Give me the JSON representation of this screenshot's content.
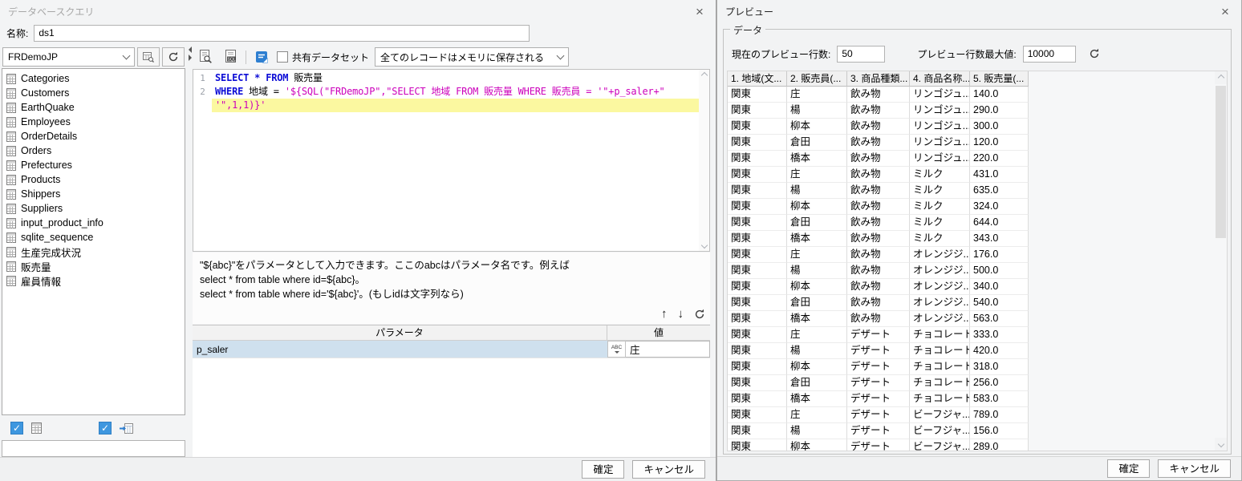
{
  "query_dialog": {
    "title": "データベースクエリ",
    "name_label": "名称:",
    "name_value": "ds1",
    "connection": {
      "selected": "FRDemoJP",
      "edit_icon": "connection-edit-icon",
      "refresh_icon": "refresh-icon"
    },
    "tables": [
      "Categories",
      "Customers",
      "EarthQuake",
      "Employees",
      "OrderDetails",
      "Orders",
      "Prefectures",
      "Products",
      "Shippers",
      "Suppliers",
      "input_product_info",
      "sqlite_sequence",
      "生産完成状況",
      "販売量",
      "雇員情報"
    ],
    "bottom_checkboxes": {
      "dataset_checked": true,
      "view_checked": true,
      "check_glyph": "✓"
    },
    "toolbar": {
      "preview_icon": "sql-preview-icon",
      "sql_icon": "sql-file-icon",
      "format_icon": "format-sql-icon",
      "share_label": "共有データセット",
      "share_checked": false,
      "storage_value": "全てのレコードはメモリに保存される"
    },
    "sql_lines": [
      {
        "num": "1",
        "highlight": false,
        "segments": [
          {
            "cls": "kw",
            "text": "SELECT"
          },
          {
            "cls": "kw",
            "text": " * "
          },
          {
            "cls": "kw",
            "text": "FROM"
          },
          {
            "cls": "plain",
            "text": " 販売量"
          }
        ]
      },
      {
        "num": "2",
        "highlight": false,
        "segments": [
          {
            "cls": "kw",
            "text": "WHERE"
          },
          {
            "cls": "plain",
            "text": " 地域 = "
          },
          {
            "cls": "str",
            "text": "'${SQL(\"FRDemoJP\",\"SELECT 地域 FROM 販売量 WHERE 販売員 = '\"+p_saler+\""
          }
        ]
      },
      {
        "num": "",
        "highlight": true,
        "segments": [
          {
            "cls": "str",
            "text": "'\",1,1)}'"
          }
        ]
      }
    ],
    "help_lines": [
      "\"${abc}\"をパラメータとして入力できます。ここのabcはパラメータ名です。例えば",
      "select * from table where id=${abc}。",
      "select * from table where id='${abc}'。(もしidは文字列なら)"
    ],
    "param_controls": {
      "up_glyph": "↑",
      "down_glyph": "↓",
      "refresh_icon": "refresh-icon"
    },
    "param_table": {
      "headers": [
        "パラメータ",
        "値"
      ],
      "rows": [
        {
          "name": "p_saler",
          "type_label": "ABC",
          "value": "庄"
        }
      ]
    },
    "filter_value": "",
    "footer": {
      "ok_label": "確定",
      "cancel_label": "キャンセル"
    }
  },
  "preview_panel": {
    "title": "プレビュー",
    "group_label": "データ",
    "current_rows_label": "現在のプレビュー行数:",
    "current_rows_value": "50",
    "max_rows_label": "プレビュー行数最大値:",
    "max_rows_value": "10000",
    "refresh_icon": "refresh-icon",
    "table": {
      "headers": [
        "1. 地域(文...",
        "2. 販売員(...",
        "3. 商品種類...",
        "4. 商品名称...",
        "5. 販売量(..."
      ],
      "rows": [
        [
          "関東",
          "庄",
          "飲み物",
          "リンゴジュ...",
          "140.0"
        ],
        [
          "関東",
          "楊",
          "飲み物",
          "リンゴジュ...",
          "290.0"
        ],
        [
          "関東",
          "柳本",
          "飲み物",
          "リンゴジュ...",
          "300.0"
        ],
        [
          "関東",
          "倉田",
          "飲み物",
          "リンゴジュ...",
          "120.0"
        ],
        [
          "関東",
          "橋本",
          "飲み物",
          "リンゴジュ...",
          "220.0"
        ],
        [
          "関東",
          "庄",
          "飲み物",
          "ミルク",
          "431.0"
        ],
        [
          "関東",
          "楊",
          "飲み物",
          "ミルク",
          "635.0"
        ],
        [
          "関東",
          "柳本",
          "飲み物",
          "ミルク",
          "324.0"
        ],
        [
          "関東",
          "倉田",
          "飲み物",
          "ミルク",
          "644.0"
        ],
        [
          "関東",
          "橋本",
          "飲み物",
          "ミルク",
          "343.0"
        ],
        [
          "関東",
          "庄",
          "飲み物",
          "オレンジジ...",
          "176.0"
        ],
        [
          "関東",
          "楊",
          "飲み物",
          "オレンジジ...",
          "500.0"
        ],
        [
          "関東",
          "柳本",
          "飲み物",
          "オレンジジ...",
          "340.0"
        ],
        [
          "関東",
          "倉田",
          "飲み物",
          "オレンジジ...",
          "540.0"
        ],
        [
          "関東",
          "橋本",
          "飲み物",
          "オレンジジ...",
          "563.0"
        ],
        [
          "関東",
          "庄",
          "デザート",
          "チョコレート",
          "333.0"
        ],
        [
          "関東",
          "楊",
          "デザート",
          "チョコレート",
          "420.0"
        ],
        [
          "関東",
          "柳本",
          "デザート",
          "チョコレート",
          "318.0"
        ],
        [
          "関東",
          "倉田",
          "デザート",
          "チョコレート",
          "256.0"
        ],
        [
          "関東",
          "橋本",
          "デザート",
          "チョコレート",
          "583.0"
        ],
        [
          "関東",
          "庄",
          "デザート",
          "ビーフジャ...",
          "789.0"
        ],
        [
          "関東",
          "楊",
          "デザート",
          "ビーフジャ...",
          "156.0"
        ],
        [
          "関東",
          "柳本",
          "デザート",
          "ビーフジャ...",
          "289.0"
        ]
      ]
    },
    "footer": {
      "ok_label": "確定",
      "cancel_label": "キャンセル"
    }
  }
}
